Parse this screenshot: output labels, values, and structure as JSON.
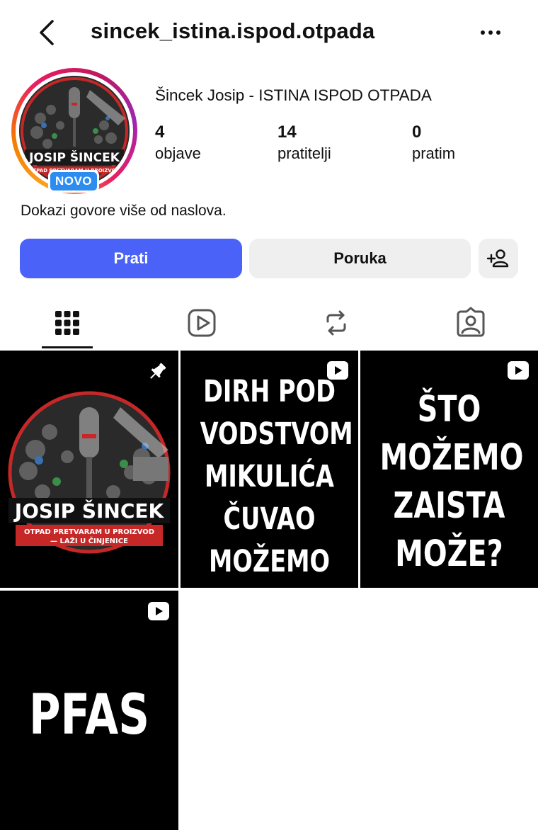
{
  "header": {
    "username": "sincek_istina.ispod.otpada",
    "back_icon": "chevron-left-icon",
    "more_icon": "more-horizontal-icon"
  },
  "profile": {
    "display_name": "Šincek Josip - ISTINA ISPOD OTPADA",
    "badge": "NOVO",
    "avatar": {
      "title": "JOSIP ŠINCEK",
      "subtitle": "OTPAD PRETVARAM U PROIZVOD"
    },
    "stats": [
      {
        "value": "4",
        "label": "objave"
      },
      {
        "value": "14",
        "label": "pratitelji"
      },
      {
        "value": "0",
        "label": "pratim"
      }
    ],
    "bio": "Dokazi govore više od naslova."
  },
  "actions": {
    "follow_label": "Prati",
    "message_label": "Poruka",
    "add_user_icon": "add-user-icon"
  },
  "tabs": [
    {
      "icon": "grid-icon",
      "active": true
    },
    {
      "icon": "reels-icon",
      "active": false
    },
    {
      "icon": "reposts-icon",
      "active": false
    },
    {
      "icon": "tagged-icon",
      "active": false
    }
  ],
  "posts": [
    {
      "type": "image",
      "pinned": true,
      "title": "JOSIP ŠINCEK",
      "subtitle": "OTPAD PRETVARAM U PROIZVOD",
      "subtitle2": "— LAŽI U ČINJENICE"
    },
    {
      "type": "reel",
      "text": "DIRH POD\nVODSTVOM\nMIKULIĆA\nČUVAO\nMOŽEMO"
    },
    {
      "type": "reel",
      "text": "ŠTO\nMOŽEMO\nZAISTA\nMOŽE?"
    },
    {
      "type": "reel",
      "text": "PFAS"
    }
  ],
  "colors": {
    "follow_button": "#4a62f7",
    "secondary_button": "#efefef",
    "badge": "#2d8cf0",
    "accent_red": "#c62828"
  }
}
